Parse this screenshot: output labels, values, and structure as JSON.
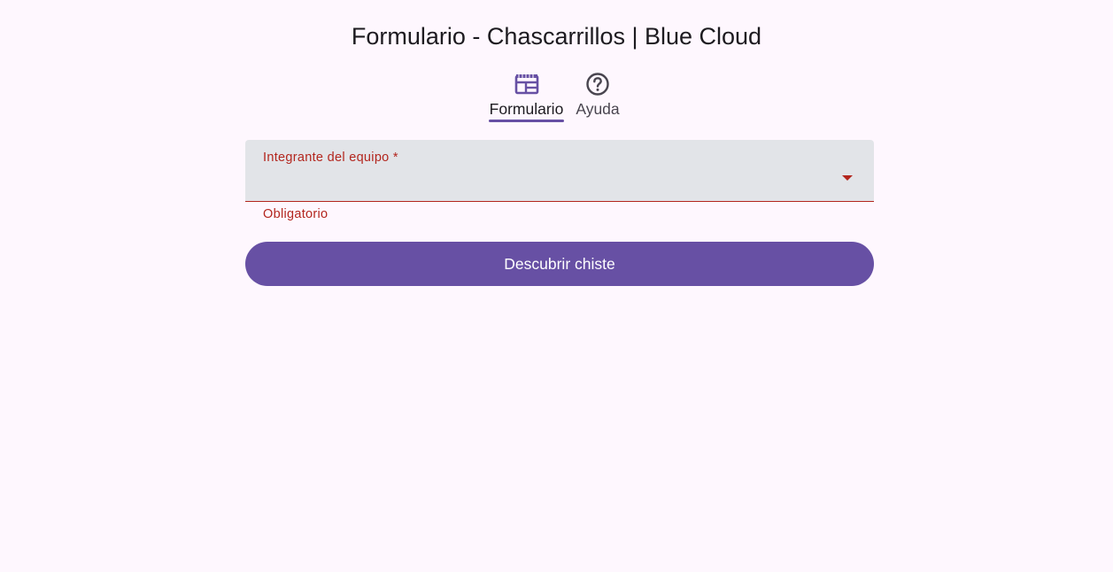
{
  "page": {
    "title": "Formulario - Chascarrillos | Blue Cloud"
  },
  "tabs": [
    {
      "label": "Formulario",
      "icon": "table-chart-icon",
      "active": true
    },
    {
      "label": "Ayuda",
      "icon": "help-circle-icon",
      "active": false
    }
  ],
  "form": {
    "member_field": {
      "label": "Integrante del equipo *",
      "value": "",
      "helper_text": "Obligatorio",
      "state": "error"
    },
    "submit_label": "Descubrir chiste"
  },
  "colors": {
    "background": "#fef7fe",
    "primary": "#6750a4",
    "error": "#b3261e",
    "field_fill": "#e2e4e8",
    "text": "#1d1b20"
  }
}
